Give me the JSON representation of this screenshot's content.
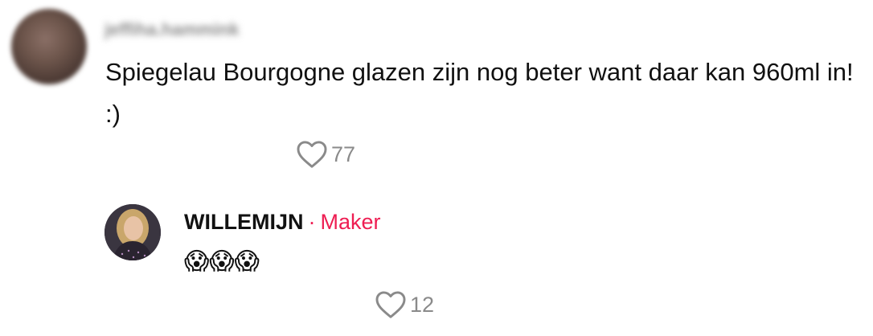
{
  "comment": {
    "author": "jeffiha.hammink",
    "text": "Spiegelau Bourgogne glazen zijn nog beter want daar kan 960ml in! :)",
    "likes": "77"
  },
  "reply": {
    "author": "WILLEMIJN",
    "separator": "·",
    "badge": "Maker",
    "text": "😱😱😱",
    "likes": "12"
  },
  "icons": {
    "like": "heart-outline-icon"
  },
  "colors": {
    "accent": "#ee1d52",
    "muted": "#8a8a8a",
    "text": "#111111"
  }
}
